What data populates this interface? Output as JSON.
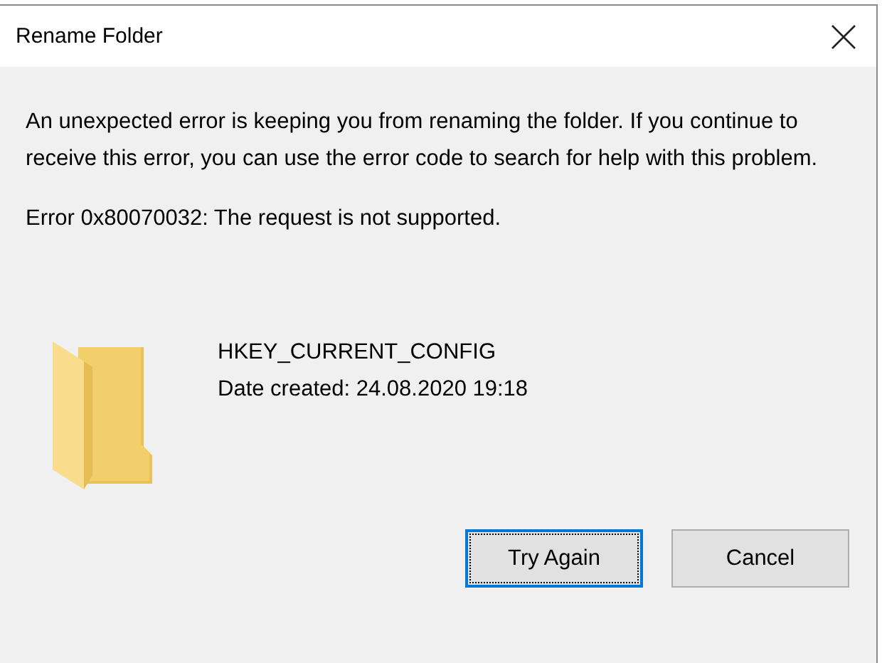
{
  "window": {
    "title": "Rename Folder"
  },
  "message": "An unexpected error is keeping you from renaming the folder. If you continue to receive this error, you can use the error code to search for help with this problem.",
  "error": "Error 0x80070032: The request is not supported.",
  "item": {
    "name": "HKEY_CURRENT_CONFIG",
    "date": "Date created: 24.08.2020 19:18"
  },
  "buttons": [
    {
      "label": "Try Again",
      "focused": true
    },
    {
      "label": "Cancel",
      "focused": false
    }
  ]
}
